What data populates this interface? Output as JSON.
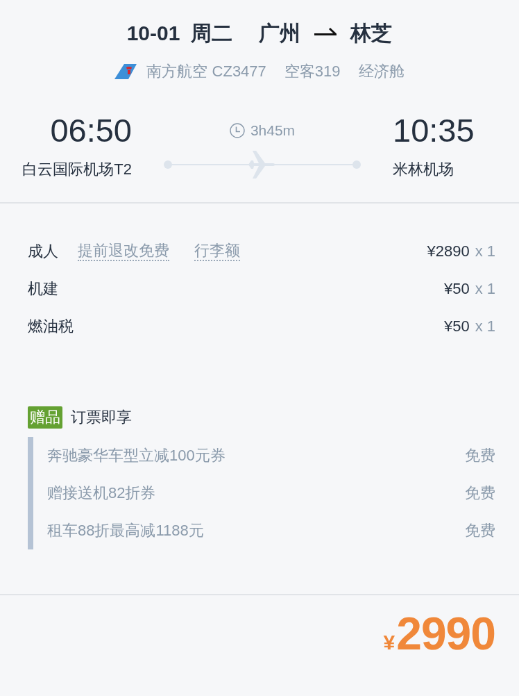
{
  "header": {
    "date": "10-01",
    "weekday": "周二",
    "origin": "广州",
    "destination": "林芝"
  },
  "flight_info": {
    "airline": "南方航空 CZ3477",
    "aircraft": "空客319",
    "cabin": "经济舱"
  },
  "itinerary": {
    "departure": {
      "time": "06:50",
      "airport": "白云国际机场T2"
    },
    "duration": "3h45m",
    "arrival": {
      "time": "10:35",
      "airport": "米林机场"
    }
  },
  "fares": [
    {
      "label": "成人",
      "links": [
        "提前退改免费",
        "行李额"
      ],
      "price": "¥2890",
      "quantity": "x 1"
    },
    {
      "label": "机建",
      "price": "¥50",
      "quantity": "x 1"
    },
    {
      "label": "燃油税",
      "price": "¥50",
      "quantity": "x 1"
    }
  ],
  "gifts": {
    "badge": "赠品",
    "title": "订票即享",
    "items": [
      {
        "name": "奔驰豪华车型立减100元券",
        "price": "免费"
      },
      {
        "name": "赠接送机82折券",
        "price": "免费"
      },
      {
        "name": "租车88折最高减1188元",
        "price": "免费"
      }
    ]
  },
  "total": {
    "currency": "¥",
    "amount": "2990"
  }
}
